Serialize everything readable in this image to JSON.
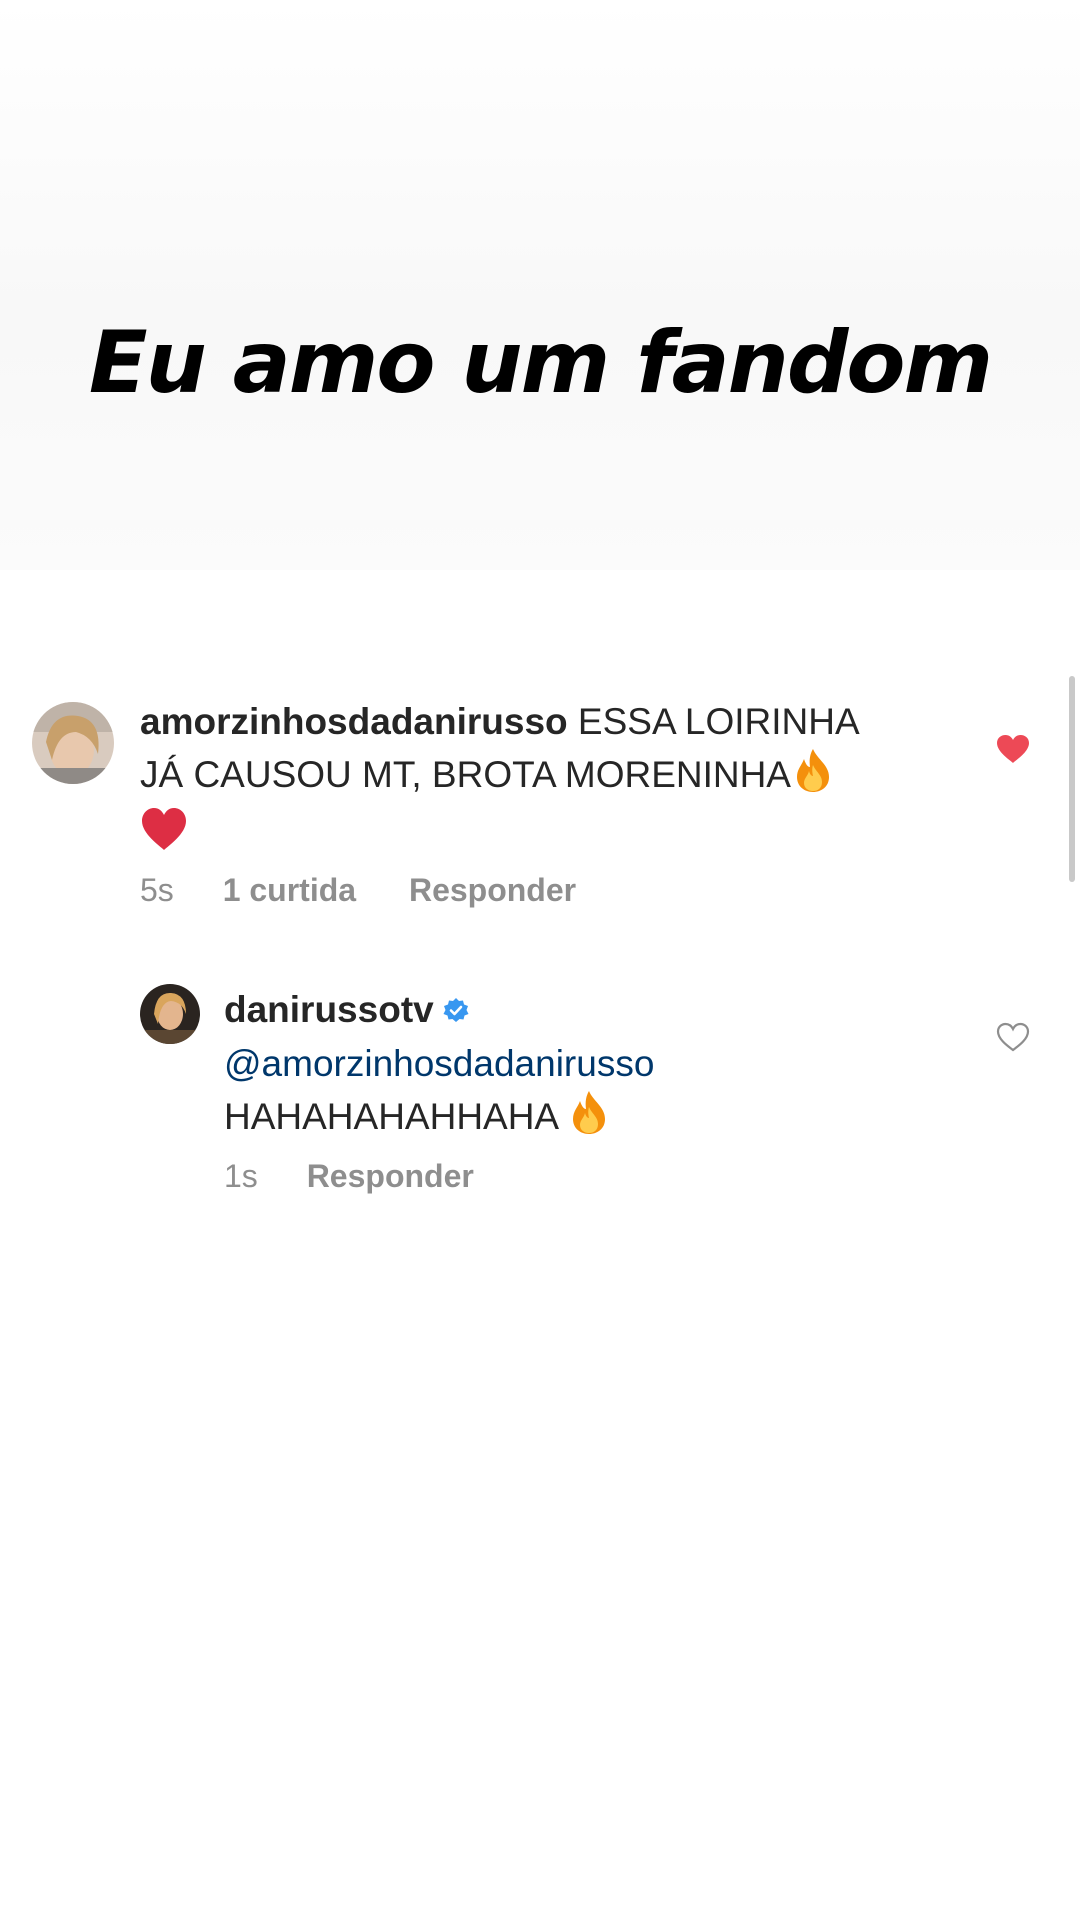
{
  "story": {
    "headline": "Eu amo um fandom"
  },
  "comments": [
    {
      "username": "amorzinhosdadanirusso",
      "text_line1": " ESSA LOIRINHA",
      "text_line2": "JÁ CAUSOU MT, BROTA MORENINHA",
      "emojis": [
        "fire",
        "red-heart"
      ],
      "time": "5s",
      "likes": "1 curtida",
      "reply_label": "Responder",
      "liked": true
    },
    {
      "username": "danirussotv",
      "verified": true,
      "mention": "@amorzinhosdadanirusso",
      "text": "HAHAHAHAHHAHA ",
      "emojis": [
        "fire"
      ],
      "time": "1s",
      "reply_label": "Responder",
      "liked": false
    }
  ],
  "colors": {
    "like_red": "#ed4956",
    "verified_blue": "#3897f0",
    "mention_blue": "#00376b",
    "meta_gray": "#8e8e8e"
  }
}
